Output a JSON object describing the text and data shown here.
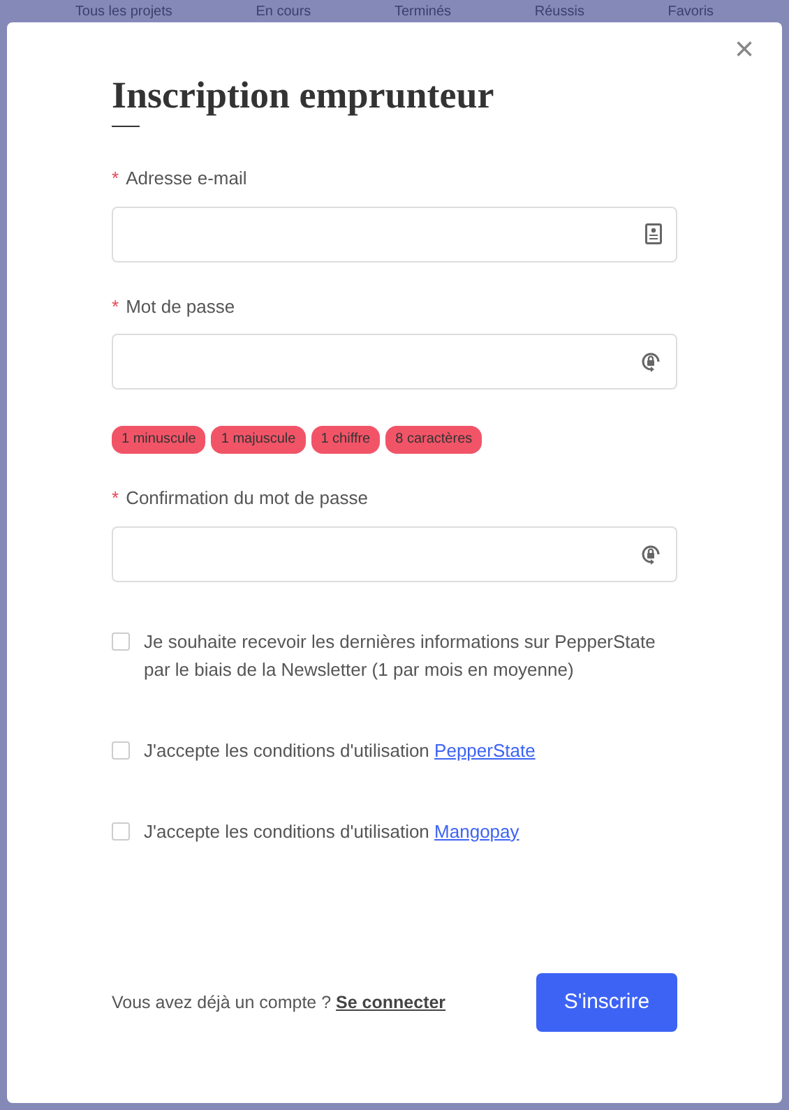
{
  "background_tabs": [
    "Tous les projets",
    "En cours",
    "Terminés",
    "Réussis",
    "Favoris"
  ],
  "dialog": {
    "close": "×",
    "title": "Inscription emprunteur",
    "fields": [
      {
        "required_mark": "*",
        "label": "Adresse e-mail",
        "kind": "email"
      },
      {
        "required_mark": "*",
        "label": "Mot de passe",
        "kind": "password"
      },
      {
        "required_mark": "*",
        "label": "Confirmation du mot de passe",
        "kind": "password"
      }
    ],
    "password_rules": [
      {
        "label": "1 minuscule",
        "met": false
      },
      {
        "label": "1 majuscule",
        "met": false
      },
      {
        "label": "1 chiffre",
        "met": false
      },
      {
        "label": "8 caractères",
        "met": false
      }
    ],
    "checkboxes": [
      {
        "label": "Je souhaite recevoir les dernières informations sur PepperState par le biais de la Newsletter (1 par mois en moyenne)",
        "checked": false
      },
      {
        "label": "J'accepte les conditions d'utilisation",
        "link": "PepperState",
        "checked": false
      },
      {
        "label": "J'accepte les conditions d'utilisation",
        "link": "Mangopay",
        "checked": false
      }
    ],
    "footer": {
      "text": "Vous avez déjà un compte ?",
      "link": "Se connecter",
      "submit": "S'inscrire"
    }
  }
}
